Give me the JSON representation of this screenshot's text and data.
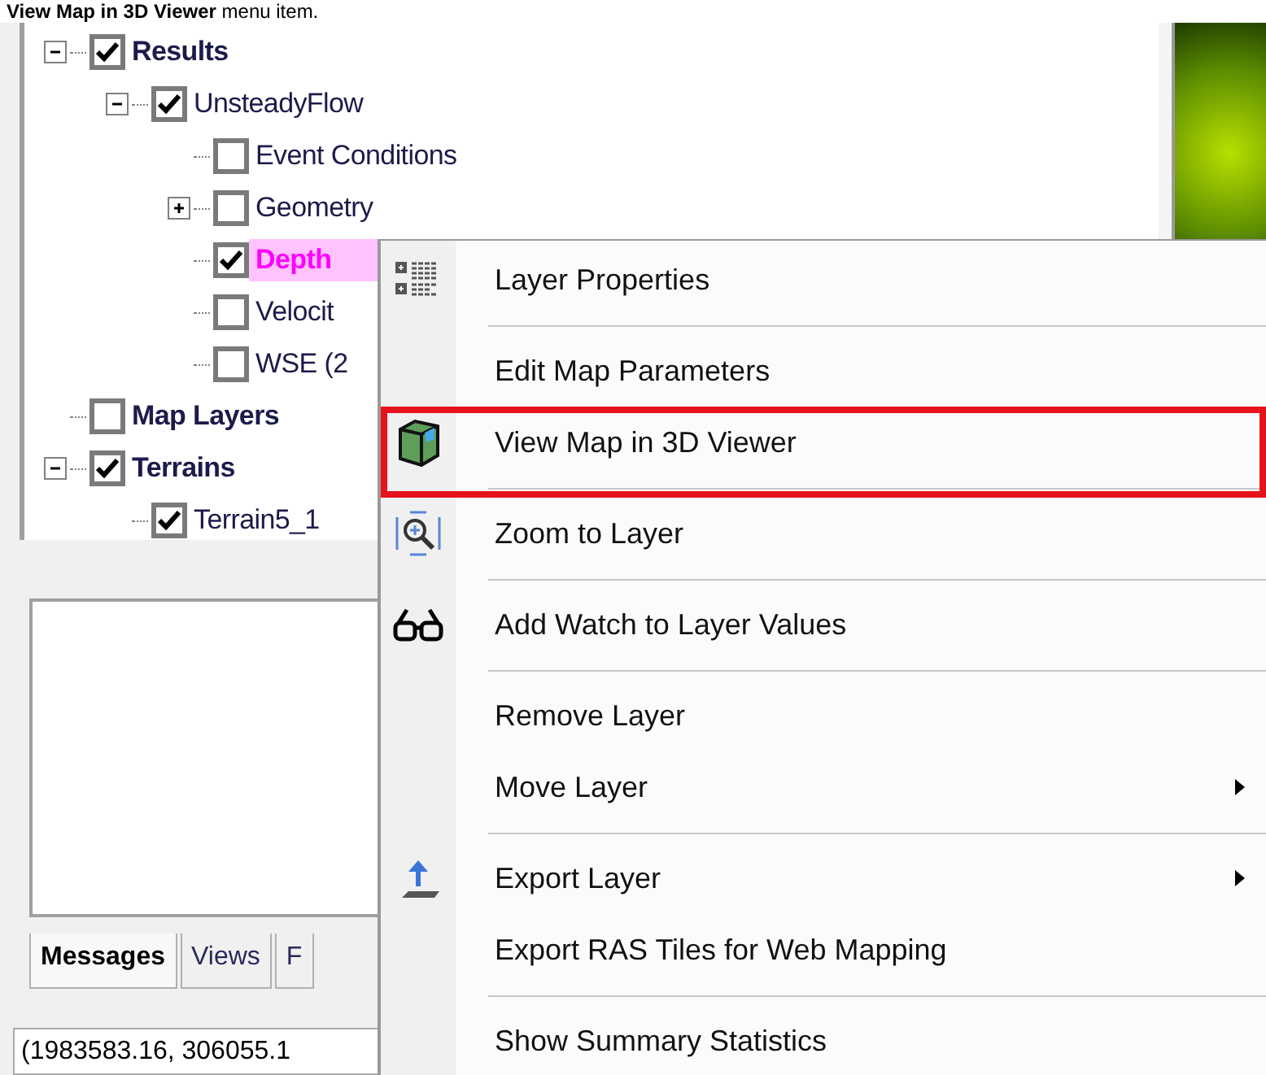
{
  "caption": "**View Map in 3D Viewer** menu item.",
  "tree": [
    {
      "label": "Results",
      "checked": true,
      "expanded": true,
      "selected": false,
      "children": [
        {
          "label": "UnsteadyFlow",
          "checked": true,
          "expanded": true,
          "selected": false,
          "children": [
            {
              "label": "Event Conditions",
              "checked": false,
              "selected": false
            },
            {
              "label": "Geometry",
              "checked": false,
              "expanded": false,
              "selected": false
            },
            {
              "label": "Depth",
              "checked": true,
              "selected": true
            },
            {
              "label": "Velocit",
              "checked": false,
              "selected": false
            },
            {
              "label": "WSE (2",
              "checked": false,
              "selected": false
            }
          ]
        }
      ]
    },
    {
      "label": "Map Layers",
      "checked": false,
      "selected": false
    },
    {
      "label": "Terrains",
      "checked": true,
      "expanded": true,
      "selected": false,
      "children": [
        {
          "label": "Terrain5_1",
          "checked": true,
          "selected": false
        }
      ]
    }
  ],
  "tabs": [
    {
      "label": "Messages",
      "selected": true
    },
    {
      "label": "Views",
      "selected": false
    },
    {
      "label": "F",
      "selected": false
    }
  ],
  "status_bar": "(1983583.16, 306055.1",
  "context_menu": [
    {
      "label": "Layer Properties",
      "highlighted": false,
      "submenu": false,
      "separator_after": true
    },
    {
      "label": "Edit Map Parameters",
      "highlighted": false,
      "submenu": false,
      "separator_after": false
    },
    {
      "label": "View Map in 3D Viewer",
      "highlighted": true,
      "submenu": false,
      "separator_after": true
    },
    {
      "label": "Zoom to Layer",
      "highlighted": false,
      "submenu": false,
      "separator_after": true
    },
    {
      "label": "Add Watch to Layer Values",
      "highlighted": false,
      "submenu": false,
      "separator_after": true
    },
    {
      "label": "Remove Layer",
      "highlighted": false,
      "submenu": false,
      "separator_after": false
    },
    {
      "label": "Move Layer",
      "highlighted": false,
      "submenu": true,
      "separator_after": true
    },
    {
      "label": "Export Layer",
      "highlighted": false,
      "submenu": true,
      "separator_after": false
    },
    {
      "label": "Export RAS Tiles for Web Mapping",
      "highlighted": false,
      "submenu": false,
      "separator_after": true
    },
    {
      "label": "Show Summary Statistics",
      "highlighted": false,
      "submenu": false,
      "separator_after": false
    }
  ]
}
